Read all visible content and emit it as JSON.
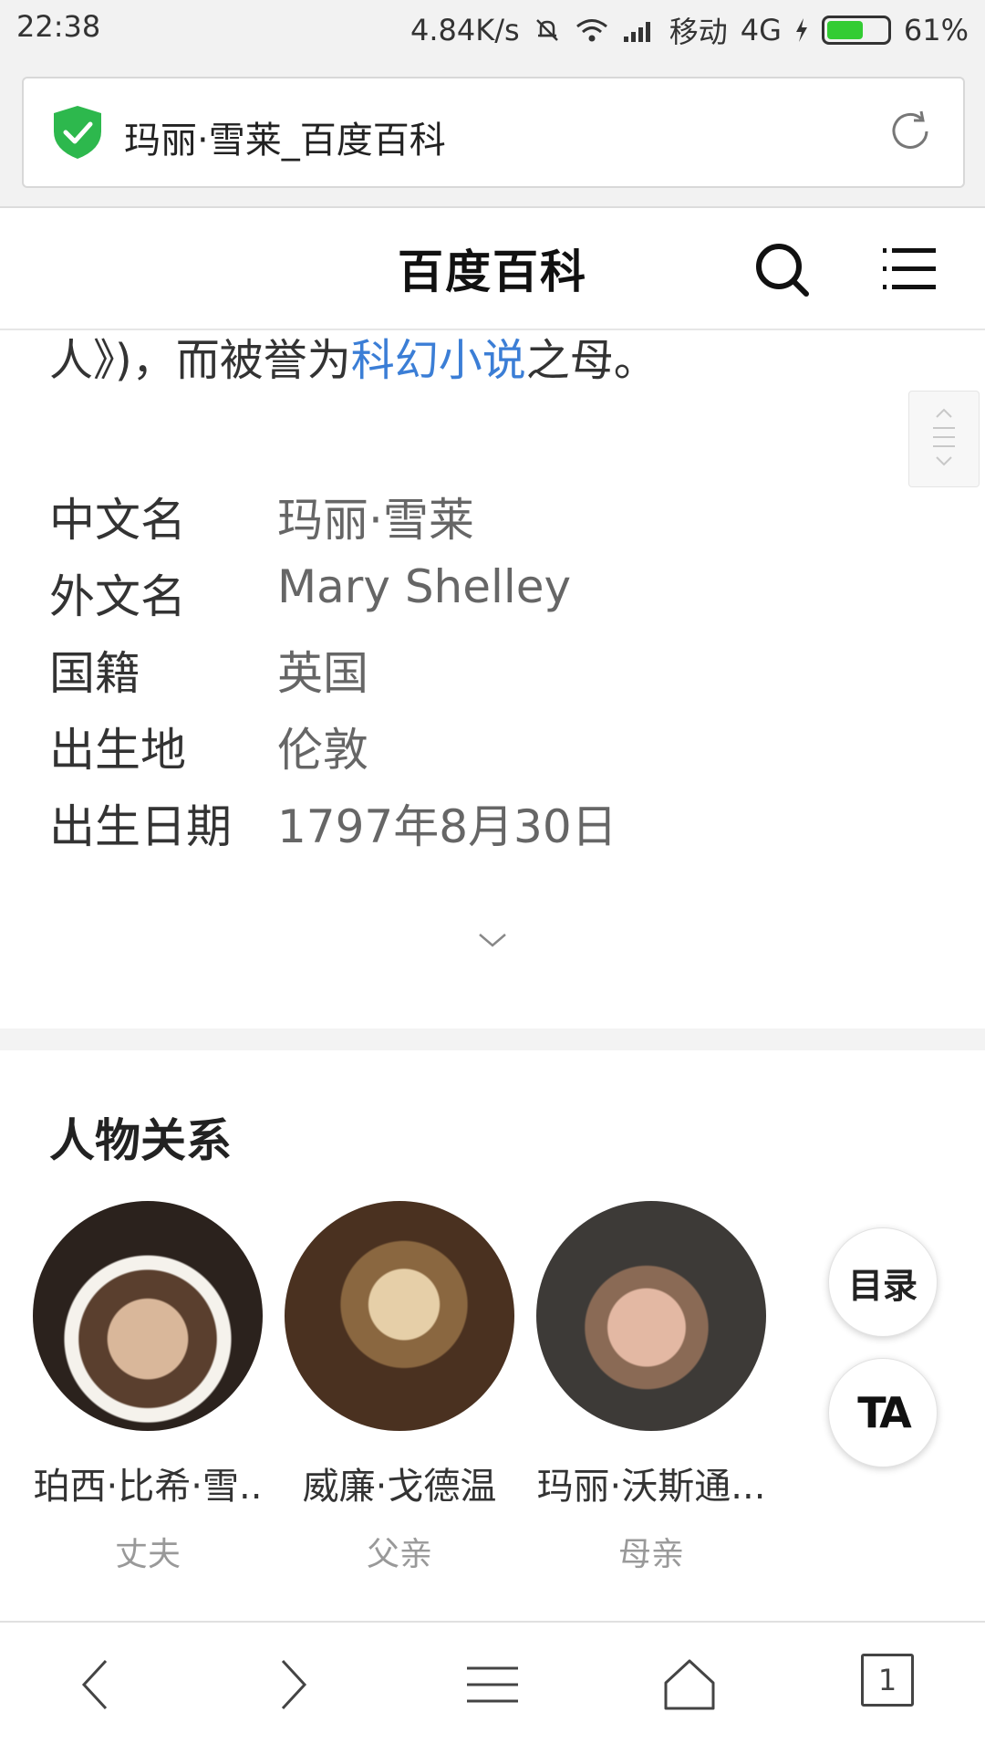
{
  "status": {
    "time": "22:38",
    "speed": "4.84K/s",
    "carrier": "移动",
    "network": "4G",
    "battery": "61%",
    "battery_level": 0.61
  },
  "browser": {
    "page_title": "玛丽·雪莱_百度百科"
  },
  "site": {
    "brand": "百度百科"
  },
  "intro": {
    "before": "人》)，而被誉为",
    "link": "科幻小说",
    "after": "之母。"
  },
  "info": [
    {
      "key": "中文名",
      "value": "玛丽·雪莱"
    },
    {
      "key": "外文名",
      "value": "Mary Shelley"
    },
    {
      "key": "国籍",
      "value": "英国"
    },
    {
      "key": "出生地",
      "value": "伦敦"
    },
    {
      "key": "出生日期",
      "value": "1797年8月30日"
    }
  ],
  "relations": {
    "heading": "人物关系",
    "items": [
      {
        "name": "珀西·比希·雪..",
        "role": "丈夫"
      },
      {
        "name": "威廉·戈德温",
        "role": "父亲"
      },
      {
        "name": "玛丽·沃斯通...",
        "role": "母亲"
      }
    ]
  },
  "floating": {
    "toc": "目录",
    "ta": "TA"
  },
  "bottom_nav": {
    "tab_count": "1"
  },
  "colors": {
    "link": "#3b7ed6",
    "shield": "#2db84d",
    "battery": "#33cc33"
  },
  "icons": [
    "shield-check-icon",
    "reload-icon",
    "search-icon",
    "menu-icon",
    "scroll-handle-icon",
    "chevron-down-icon",
    "back-icon",
    "forward-icon",
    "menu-lines-icon",
    "home-icon",
    "tabs-icon"
  ]
}
